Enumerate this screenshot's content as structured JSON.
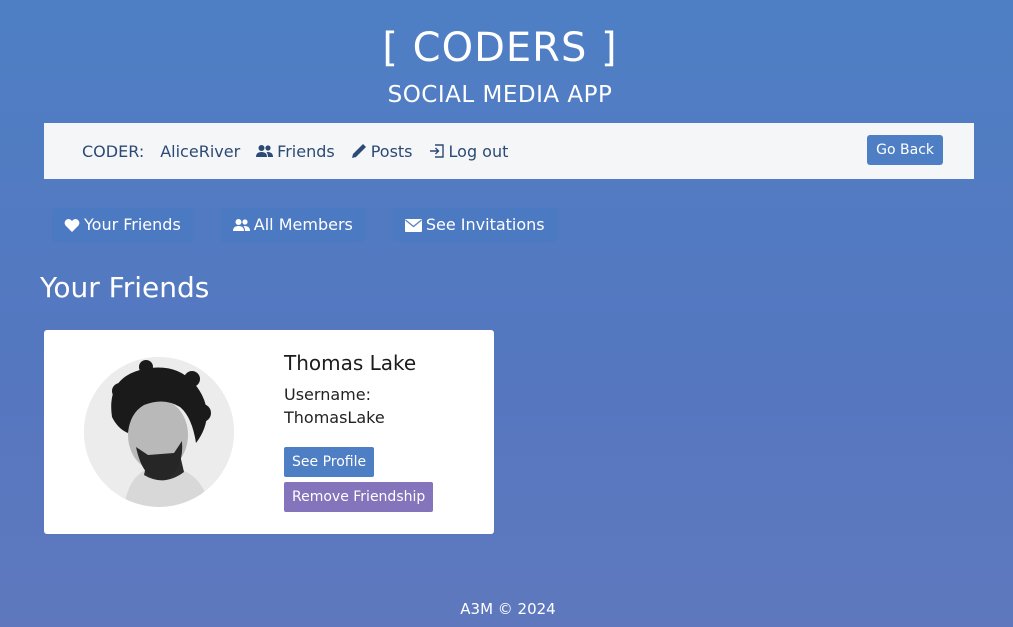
{
  "header": {
    "title": "[ CODERS ]",
    "subtitle": "SOCIAL MEDIA APP"
  },
  "navbar": {
    "coder_label": "CODER:",
    "username": "AliceRiver",
    "friends": "Friends",
    "posts": "Posts",
    "logout": "Log out",
    "go_back": "Go Back"
  },
  "tabs": [
    {
      "label": "Your Friends",
      "icon": "heart-icon"
    },
    {
      "label": "All Members",
      "icon": "users-icon"
    },
    {
      "label": "See Invitations",
      "icon": "envelope-icon"
    }
  ],
  "main": {
    "heading": "Your Friends",
    "friends": [
      {
        "name": "Thomas Lake",
        "username_label": "Username:",
        "username": "ThomasLake",
        "see_profile": "See Profile",
        "remove": "Remove Friendship"
      }
    ]
  },
  "footer": {
    "text": "A3M © 2024"
  },
  "colors": {
    "background": "#4e7fc4",
    "navbar": "#f5f6f8",
    "primary_button": "#4e7fc4",
    "remove_button": "#8474bb",
    "nav_text": "#2c4a75"
  }
}
